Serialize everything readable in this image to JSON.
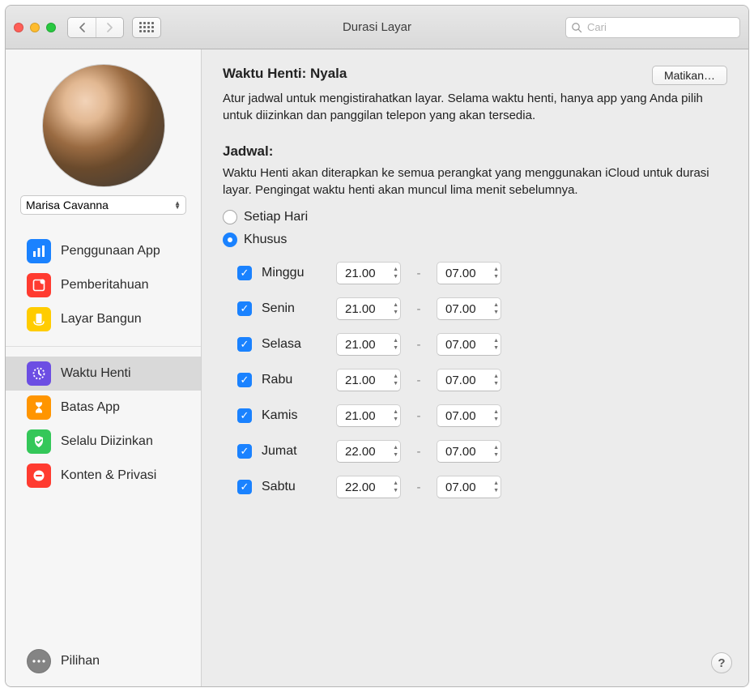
{
  "window": {
    "title": "Durasi Layar"
  },
  "search": {
    "placeholder": "Cari"
  },
  "user": {
    "name": "Marisa Cavanna"
  },
  "sidebar": {
    "items": [
      {
        "label": "Penggunaan App",
        "color": "#1a82ff",
        "iconName": "app-usage-icon"
      },
      {
        "label": "Pemberitahuan",
        "color": "#ff3b30",
        "iconName": "notifications-icon"
      },
      {
        "label": "Layar Bangun",
        "color": "#ffcc00",
        "iconName": "pickups-icon"
      }
    ],
    "items2": [
      {
        "label": "Waktu Henti",
        "color": "#6c4ee3",
        "selected": true,
        "iconName": "downtime-icon"
      },
      {
        "label": "Batas App",
        "color": "#ff9500",
        "iconName": "app-limits-icon"
      },
      {
        "label": "Selalu Diizinkan",
        "color": "#34c759",
        "iconName": "always-allowed-icon"
      },
      {
        "label": "Konten & Privasi",
        "color": "#ff3b30",
        "iconName": "content-privacy-icon"
      }
    ],
    "options": "Pilihan"
  },
  "main": {
    "heading_prefix": "Waktu Henti: ",
    "heading_status": "Nyala",
    "turn_off_button": "Matikan…",
    "desc": "Atur jadwal untuk mengistirahatkan layar. Selama waktu henti, hanya app yang Anda pilih untuk diizinkan dan panggilan telepon yang akan tersedia.",
    "schedule_label": "Jadwal:",
    "schedule_desc": "Waktu Henti akan diterapkan ke semua perangkat yang menggunakan iCloud untuk durasi layar. Pengingat waktu henti akan muncul lima menit sebelumnya.",
    "radio_every_day": "Setiap Hari",
    "radio_custom": "Khusus",
    "days": [
      {
        "name": "Minggu",
        "from": "21.00",
        "to": "07.00",
        "checked": true
      },
      {
        "name": "Senin",
        "from": "21.00",
        "to": "07.00",
        "checked": true
      },
      {
        "name": "Selasa",
        "from": "21.00",
        "to": "07.00",
        "checked": true
      },
      {
        "name": "Rabu",
        "from": "21.00",
        "to": "07.00",
        "checked": true
      },
      {
        "name": "Kamis",
        "from": "21.00",
        "to": "07.00",
        "checked": true
      },
      {
        "name": "Jumat",
        "from": "22.00",
        "to": "07.00",
        "checked": true
      },
      {
        "name": "Sabtu",
        "from": "22.00",
        "to": "07.00",
        "checked": true
      }
    ],
    "help": "?"
  }
}
